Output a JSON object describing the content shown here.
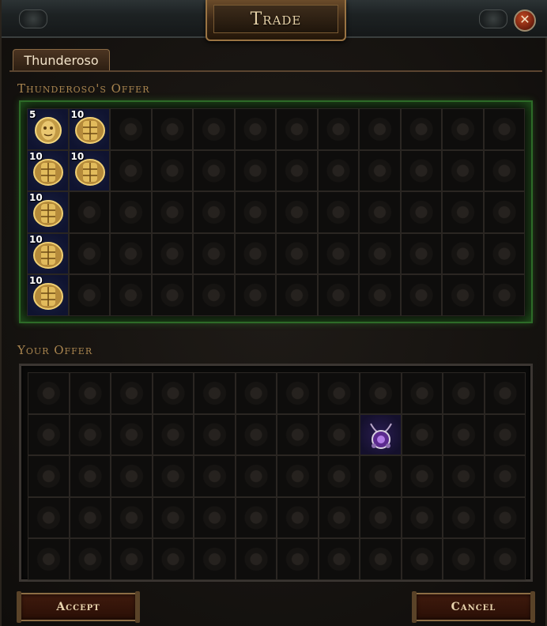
{
  "window": {
    "title": "Trade"
  },
  "tab": {
    "label": "Thunderoso"
  },
  "their_offer": {
    "label": "Thunderoso's Offer",
    "items": [
      {
        "row": 0,
        "col": 0,
        "stack": "5",
        "icon": "divine-orb-icon"
      },
      {
        "row": 0,
        "col": 1,
        "stack": "10",
        "icon": "exalted-orb-icon"
      },
      {
        "row": 1,
        "col": 0,
        "stack": "10",
        "icon": "exalted-orb-icon"
      },
      {
        "row": 1,
        "col": 1,
        "stack": "10",
        "icon": "exalted-orb-icon"
      },
      {
        "row": 2,
        "col": 0,
        "stack": "10",
        "icon": "exalted-orb-icon"
      },
      {
        "row": 3,
        "col": 0,
        "stack": "10",
        "icon": "exalted-orb-icon"
      },
      {
        "row": 4,
        "col": 0,
        "stack": "10",
        "icon": "exalted-orb-icon"
      }
    ]
  },
  "your_offer": {
    "label": "Your Offer",
    "items": [
      {
        "row": 1,
        "col": 8,
        "stack": "",
        "icon": "purple-amulet-icon"
      }
    ]
  },
  "buttons": {
    "accept": "Accept",
    "cancel": "Cancel"
  },
  "colors": {
    "offer_glow": "#2d6b28",
    "label": "#a9854f",
    "button_text": "#e9d5ae"
  }
}
